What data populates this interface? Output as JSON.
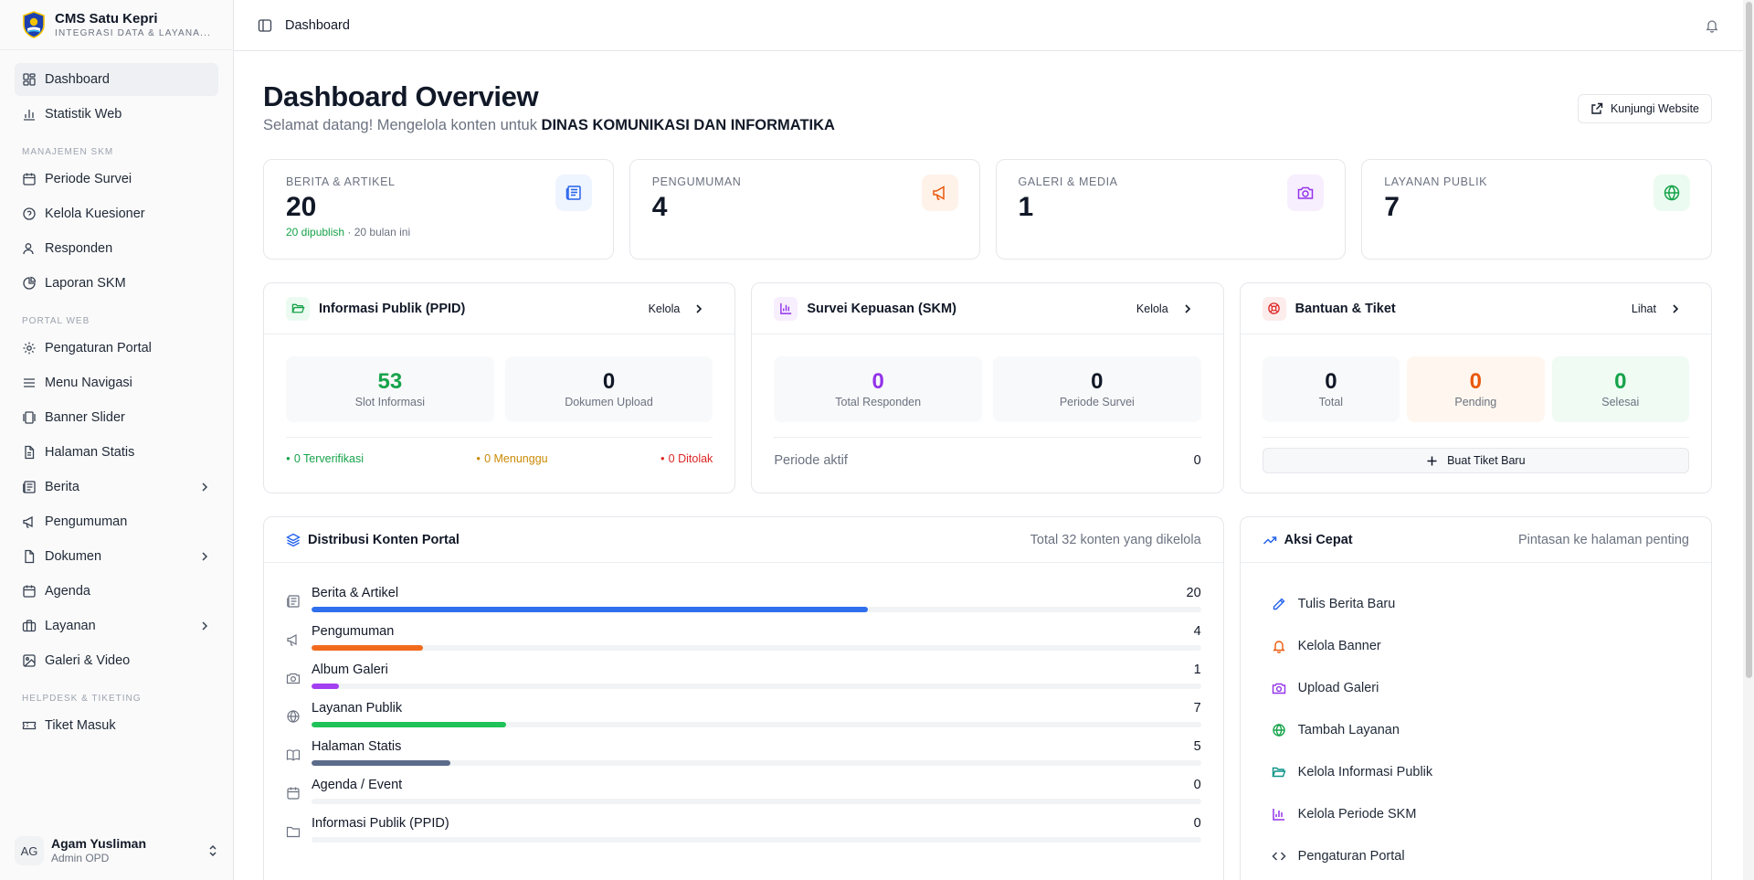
{
  "brand": {
    "title": "CMS Satu Kepri",
    "subtitle": "INTEGRASI DATA & LAYANA..."
  },
  "sidebar": {
    "items_top": [
      {
        "label": "Dashboard",
        "icon": "dashboard-icon"
      },
      {
        "label": "Statistik Web",
        "icon": "bar-chart-icon"
      }
    ],
    "group_skm": "MANAJEMEN SKM",
    "items_skm": [
      {
        "label": "Periode Survei",
        "icon": "calendar-icon"
      },
      {
        "label": "Kelola Kuesioner",
        "icon": "help-circle-icon"
      },
      {
        "label": "Responden",
        "icon": "users-icon"
      },
      {
        "label": "Laporan SKM",
        "icon": "pie-chart-icon"
      }
    ],
    "group_portal": "PORTAL WEB",
    "items_portal": [
      {
        "label": "Pengaturan Portal",
        "icon": "gear-icon"
      },
      {
        "label": "Menu Navigasi",
        "icon": "menu-icon"
      },
      {
        "label": "Banner Slider",
        "icon": "slider-icon"
      },
      {
        "label": "Halaman Statis",
        "icon": "file-icon"
      },
      {
        "label": "Berita",
        "icon": "newspaper-icon"
      },
      {
        "label": "Pengumuman",
        "icon": "megaphone-icon"
      },
      {
        "label": "Dokumen",
        "icon": "document-icon"
      },
      {
        "label": "Agenda",
        "icon": "calendar-icon"
      },
      {
        "label": "Layanan",
        "icon": "briefcase-icon"
      },
      {
        "label": "Galeri & Video",
        "icon": "image-icon"
      }
    ],
    "group_help": "HELPDESK & TIKETING",
    "items_help": [
      {
        "label": "Tiket Masuk",
        "icon": "ticket-icon"
      }
    ]
  },
  "user": {
    "initials": "AG",
    "name": "Agam Yusliman",
    "role": "Admin OPD"
  },
  "header": {
    "breadcrumb": "Dashboard"
  },
  "page": {
    "title": "Dashboard Overview",
    "subtitle_prefix": "Selamat datang! Mengelola konten untuk ",
    "subtitle_org": "DINAS KOMUNIKASI DAN INFORMATIKA",
    "visit_button": "Kunjungi Website"
  },
  "stats": [
    {
      "label": "BERITA & ARTIKEL",
      "value": "20",
      "note_green": "20 dipublish",
      "note_rest": " · 20 bulan ini",
      "color": "#2563eb",
      "bg": "#eff5ff"
    },
    {
      "label": "PENGUMUMAN",
      "value": "4",
      "color": "#ea580c",
      "bg": "#fff2e8"
    },
    {
      "label": "GALERI & MEDIA",
      "value": "1",
      "color": "#9333ea",
      "bg": "#f7eefe"
    },
    {
      "label": "LAYANAN PUBLIK",
      "value": "7",
      "color": "#16a34a",
      "bg": "#ecfbf1"
    }
  ],
  "ppid": {
    "title": "Informasi Publik (PPID)",
    "link": "Kelola",
    "tiles": [
      {
        "value": "53",
        "label": "Slot Informasi",
        "color": "#16a34a"
      },
      {
        "value": "0",
        "label": "Dokumen Upload",
        "color": "#111827"
      }
    ],
    "status": [
      {
        "text": "0 Terverifikasi",
        "color": "#16a34a"
      },
      {
        "text": "0 Menunggu",
        "color": "#ca8a04"
      },
      {
        "text": "0 Ditolak",
        "color": "#dc2626"
      }
    ]
  },
  "skm": {
    "title": "Survei Kepuasan (SKM)",
    "link": "Kelola",
    "tiles": [
      {
        "value": "0",
        "label": "Total Responden",
        "color": "#9333ea"
      },
      {
        "value": "0",
        "label": "Periode Survei",
        "color": "#111827"
      }
    ],
    "active_label": "Periode aktif",
    "active_value": "0"
  },
  "tiket": {
    "title": "Bantuan & Tiket",
    "link": "Lihat",
    "tiles": [
      {
        "value": "0",
        "label": "Total",
        "color": "#111827",
        "bg": "#f8f9fa"
      },
      {
        "value": "0",
        "label": "Pending",
        "color": "#ea580c",
        "bg": "#fff7ef"
      },
      {
        "value": "0",
        "label": "Selesai",
        "color": "#16a34a",
        "bg": "#effbf3"
      }
    ],
    "new_button": "Buat Tiket Baru"
  },
  "distribution": {
    "title": "Distribusi Konten Portal",
    "total_text": "Total 32 konten yang dikelola",
    "max": 32,
    "rows": [
      {
        "label": "Berita & Artikel",
        "value": 20,
        "color": "#2f6fed",
        "icon": "newspaper-icon"
      },
      {
        "label": "Pengumuman",
        "value": 4,
        "color": "#f26b1d",
        "icon": "megaphone-icon"
      },
      {
        "label": "Album Galeri",
        "value": 1,
        "color": "#a33ff0",
        "icon": "camera-icon"
      },
      {
        "label": "Layanan Publik",
        "value": 7,
        "color": "#1fc259",
        "icon": "globe-icon"
      },
      {
        "label": "Halaman Statis",
        "value": 5,
        "color": "#5b6b8a",
        "icon": "book-icon"
      },
      {
        "label": "Agenda / Event",
        "value": 0,
        "color": "#9ca3af",
        "icon": "calendar-icon"
      },
      {
        "label": "Informasi Publik (PPID)",
        "value": 0,
        "color": "#9ca3af",
        "icon": "folder-icon"
      }
    ]
  },
  "quick": {
    "title": "Aksi Cepat",
    "subtitle": "Pintasan ke halaman penting",
    "items": [
      {
        "label": "Tulis Berita Baru",
        "icon": "pencil-icon",
        "color": "#2563eb"
      },
      {
        "label": "Kelola Banner",
        "icon": "bell-icon",
        "color": "#ea580c"
      },
      {
        "label": "Upload Galeri",
        "icon": "camera-icon",
        "color": "#9333ea"
      },
      {
        "label": "Tambah Layanan",
        "icon": "globe-icon",
        "color": "#16a34a"
      },
      {
        "label": "Kelola Informasi Publik",
        "icon": "folder-icon",
        "color": "#0d9488"
      },
      {
        "label": "Kelola Periode SKM",
        "icon": "bar-chart-icon",
        "color": "#9333ea"
      },
      {
        "label": "Pengaturan Portal",
        "icon": "code-icon",
        "color": "#374151"
      }
    ]
  }
}
